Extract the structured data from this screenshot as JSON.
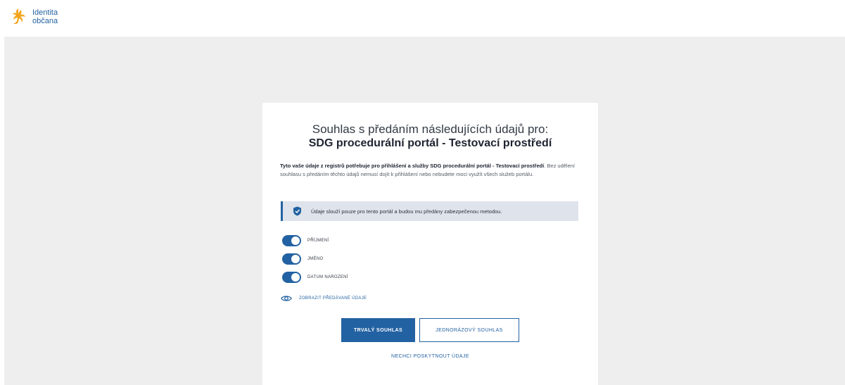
{
  "brand": {
    "line1": "Identita",
    "line2": "občana",
    "accent": "#2362a2",
    "logo_color": "#f2a51b"
  },
  "consent": {
    "heading": "Souhlas s předáním následujících údajů pro:",
    "portal_name": "SDG procedurální portál - Testovací prostředí",
    "description_bold_part1": "Tyto vaše údaje z registrů potřebuje pro přihlášení a služby SDG procedurální portál - Testovací prostředí",
    "description_rest": ". Bez udělení souhlasu s předáním těchto údajů nemusí dojít k přihlášení nebo nebudete moci využít všech služeb portálu.",
    "info_text": "Údaje slouží pouze pro tento portál a budou mu předány zabezpečenou metodou.",
    "fields": [
      {
        "label": "PŘÍJMENÍ",
        "enabled": true
      },
      {
        "label": "JMÉNO",
        "enabled": true
      },
      {
        "label": "DATUM NAROZENÍ",
        "enabled": true
      }
    ],
    "show_data_label": "ZOBRAZIT PŘEDÁVANÉ ÚDAJE",
    "permanent_button": "TRVALÝ SOUHLAS",
    "one_time_button": "JEDNORÁZOVÝ SOUHLAS",
    "decline_link": "NECHCI POSKYTNOUT ÚDAJE"
  }
}
